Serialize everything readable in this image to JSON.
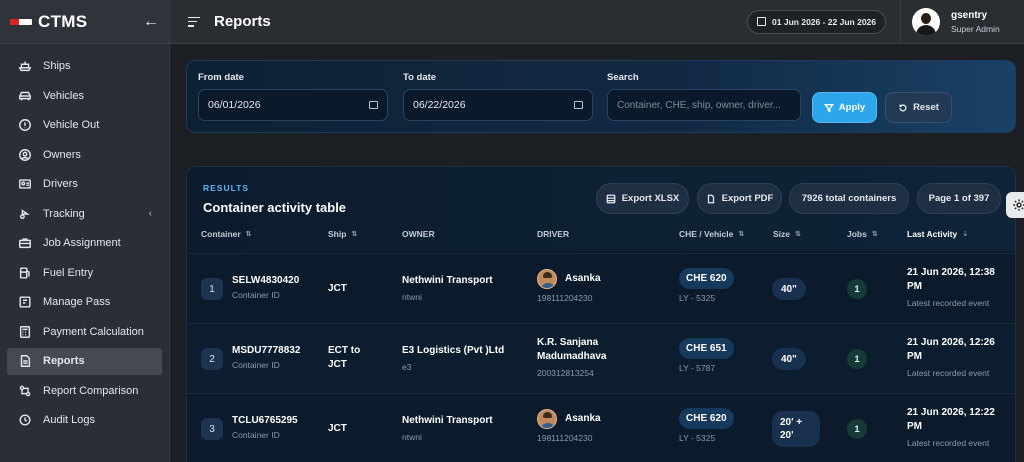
{
  "app": {
    "title": "CTMS"
  },
  "sidebar": {
    "items": [
      {
        "label": "Ships",
        "icon": "ship-icon"
      },
      {
        "label": "Vehicles",
        "icon": "car-icon"
      },
      {
        "label": "Vehicle Out",
        "icon": "alert-circle-icon"
      },
      {
        "label": "Owners",
        "icon": "user-circle-icon"
      },
      {
        "label": "Drivers",
        "icon": "id-card-icon"
      },
      {
        "label": "Tracking",
        "icon": "route-icon"
      },
      {
        "label": "Job Assignment",
        "icon": "briefcase-icon"
      },
      {
        "label": "Fuel Entry",
        "icon": "fuel-icon"
      },
      {
        "label": "Manage Pass",
        "icon": "pass-icon"
      },
      {
        "label": "Payment Calculation",
        "icon": "calculator-icon"
      },
      {
        "label": "Reports",
        "icon": "report-icon"
      },
      {
        "label": "Report Comparison",
        "icon": "compare-icon"
      },
      {
        "label": "Audit Logs",
        "icon": "history-icon"
      }
    ]
  },
  "header": {
    "title": "Reports",
    "date_range": "01 Jun 2026 - 22 Jun 2026",
    "user": {
      "name": "gsentry",
      "role": "Super Admin"
    }
  },
  "filters": {
    "from_label": "From date",
    "from_value": "06/01/2026",
    "to_label": "To date",
    "to_value": "06/22/2026",
    "search_label": "Search",
    "search_placeholder": "Container, CHE, ship, owner, driver...",
    "apply_label": "Apply",
    "reset_label": "Reset"
  },
  "results": {
    "kicker": "RESULTS",
    "title": "Container activity table",
    "export_xlsx": "Export XLSX",
    "export_pdf": "Export PDF",
    "total": "7926 total containers",
    "page": "Page 1 of 397",
    "columns": [
      "Container",
      "Ship",
      "OWNER",
      "DRIVER",
      "CHE / Vehicle",
      "Size",
      "Jobs",
      "Last Activity"
    ],
    "rows": [
      {
        "idx": "1",
        "container": "SELW4830420",
        "container_sub": "Container ID",
        "ship": "JCT",
        "owner": "Nethwini Transport",
        "owner_sub": "ntwni",
        "driver": "Asanka",
        "driver_sub": "198111204230",
        "che": "CHE 620",
        "vehicle": "LY - 5325",
        "size": "40\"",
        "jobs": "1",
        "activity": "21 Jun 2026, 12:38 PM",
        "activity_sub": "Latest recorded event"
      },
      {
        "idx": "2",
        "container": "MSDU7778832",
        "container_sub": "Container ID",
        "ship": "ECT to JCT",
        "owner": "E3 Logistics (Pvt )Ltd",
        "owner_sub": "e3",
        "driver": "K.R. Sanjana Madumadhava",
        "driver_sub": "200312813254",
        "che": "CHE 651",
        "vehicle": "LY - 5787",
        "size": "40\"",
        "jobs": "1",
        "activity": "21 Jun 2026, 12:26 PM",
        "activity_sub": "Latest recorded event"
      },
      {
        "idx": "3",
        "container": "TCLU6765295",
        "container_sub": "Container ID",
        "ship": "JCT",
        "owner": "Nethwini Transport",
        "owner_sub": "ntwni",
        "driver": "Asanka",
        "driver_sub": "198111204230",
        "che": "CHE 620",
        "vehicle": "LY - 5325",
        "size": "20' + 20'",
        "jobs": "1",
        "activity": "21 Jun 2026, 12:22 PM",
        "activity_sub": "Latest recorded event"
      }
    ]
  }
}
